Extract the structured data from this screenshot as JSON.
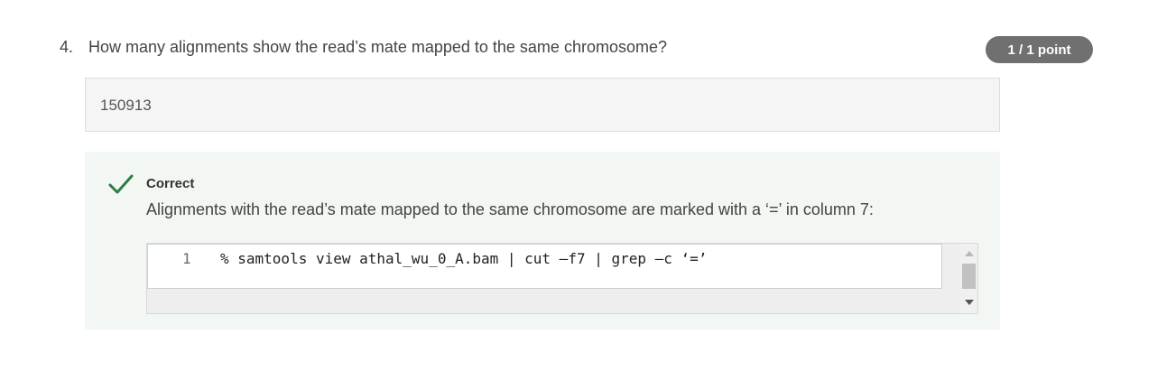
{
  "question": {
    "number": "4.",
    "text": "How many alignments show the read’s mate mapped to the same chromosome?",
    "score": "1 / 1 point"
  },
  "answer": {
    "value": "150913"
  },
  "feedback": {
    "status": "Correct",
    "icon": "check-icon",
    "status_color": "#2e7d45",
    "explanation": "Alignments with the read’s mate mapped to the same chromosome are marked with a ‘=’ in column 7:",
    "code": {
      "lines": [
        {
          "number": "1",
          "text": "% samtools view athal_wu_0_A.bam | cut –f7 | grep –c ‘=’"
        }
      ]
    }
  }
}
